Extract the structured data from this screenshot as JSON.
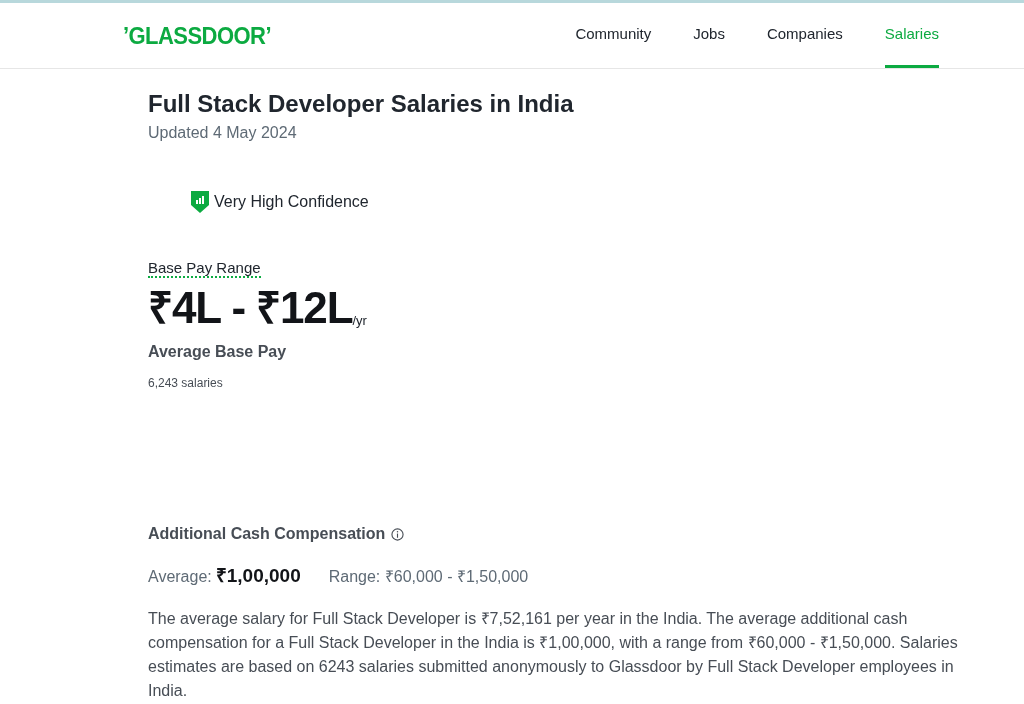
{
  "header": {
    "logo": "’GLASSDOOR’",
    "nav": [
      {
        "label": "Community",
        "selected": false
      },
      {
        "label": "Jobs",
        "selected": false
      },
      {
        "label": "Companies",
        "selected": false
      },
      {
        "label": "Salaries",
        "selected": true
      }
    ]
  },
  "title": "Full Stack Developer Salaries in India",
  "updated": "Updated 4 May 2024",
  "confidence": "Very High Confidence",
  "base_pay": {
    "label": "Base Pay Range",
    "range": "₹4L - ₹12L",
    "unit": "/yr",
    "caption": "Average Base Pay",
    "count": "6,243 salaries"
  },
  "additional": {
    "heading": "Additional Cash Compensation",
    "average_label": "Average:",
    "average": "₹1,00,000",
    "range": "Range: ₹60,000 - ₹1,50,000"
  },
  "description": "The average salary for Full Stack Developer is ₹7,52,161 per year in the India. The average additional cash compensation for a Full Stack Developer in the India is ₹1,00,000, with a range from ₹60,000 - ₹1,50,000. Salaries estimates are based on 6243 salaries submitted anonymously to Glassdoor by Full Stack Developer employees in India."
}
